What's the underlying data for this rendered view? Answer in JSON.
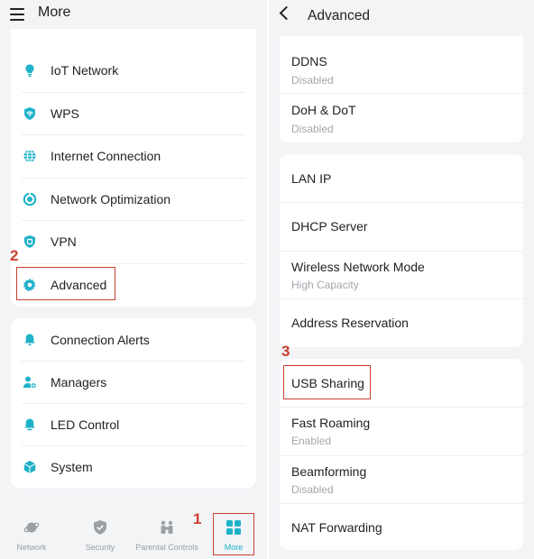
{
  "left": {
    "title": "More",
    "menu_group_1": [
      {
        "label": "IoT Network",
        "icon": "bulb-icon"
      },
      {
        "label": "WPS",
        "icon": "wps-icon"
      },
      {
        "label": "Internet Connection",
        "icon": "globe-icon"
      },
      {
        "label": "Network Optimization",
        "icon": "optimization-icon"
      },
      {
        "label": "VPN",
        "icon": "vpn-shield-icon"
      },
      {
        "label": "Advanced",
        "icon": "gear-icon"
      }
    ],
    "menu_group_2": [
      {
        "label": "Connection Alerts",
        "icon": "bell-icon"
      },
      {
        "label": "Managers",
        "icon": "managers-icon"
      },
      {
        "label": "LED Control",
        "icon": "led-icon"
      },
      {
        "label": "System",
        "icon": "cube-icon"
      }
    ],
    "bottom_nav": [
      {
        "label": "Network",
        "icon": "planet-icon"
      },
      {
        "label": "Security",
        "icon": "shield-check-icon"
      },
      {
        "label": "Parental Controls",
        "icon": "family-icon"
      },
      {
        "label": "More",
        "icon": "grid-icon",
        "active": true
      }
    ]
  },
  "right": {
    "title": "Advanced",
    "group_1": [
      {
        "label": "DDNS",
        "sub": "Disabled"
      },
      {
        "label": "DoH & DoT",
        "sub": "Disabled"
      }
    ],
    "group_2": [
      {
        "label": "LAN IP"
      },
      {
        "label": "DHCP Server"
      },
      {
        "label": "Wireless Network Mode",
        "sub": "High Capacity"
      },
      {
        "label": "Address Reservation"
      }
    ],
    "group_3": [
      {
        "label": "USB Sharing"
      },
      {
        "label": "Fast Roaming",
        "sub": "Enabled"
      },
      {
        "label": "Beamforming",
        "sub": "Disabled"
      },
      {
        "label": "NAT Forwarding"
      }
    ]
  },
  "annotations": {
    "step1": "1",
    "step2": "2",
    "step3": "3"
  },
  "colors": {
    "accent": "#1fb2c9",
    "highlight": "#c9402f",
    "subtext": "#a3a7ad",
    "background": "#f3f4f6"
  }
}
